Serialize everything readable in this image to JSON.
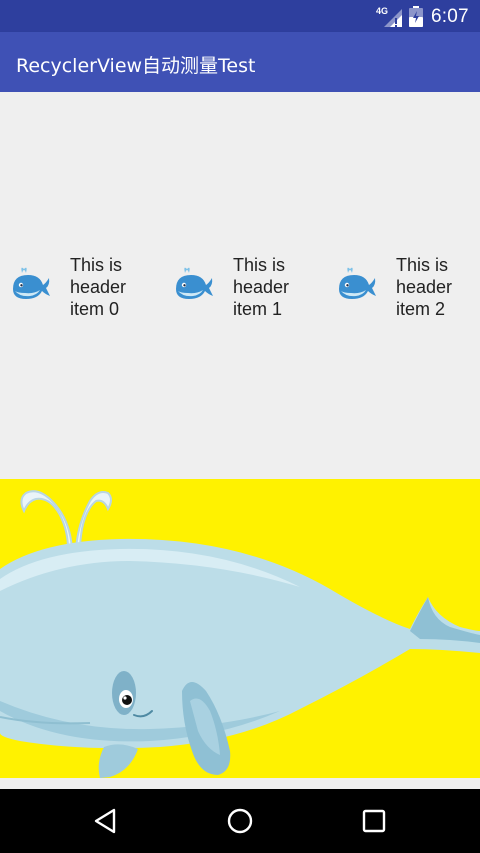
{
  "status_bar": {
    "time": "6:07",
    "network_label": "4G",
    "icons": [
      "signal-4g-icon",
      "battery-icon"
    ]
  },
  "toolbar": {
    "title": "RecyclerView自动测量Test"
  },
  "header_items": [
    {
      "line1": "This is",
      "line2": "header",
      "line3": "item 0",
      "icon": "whale-icon"
    },
    {
      "line1": "This is",
      "line2": "header",
      "line3": "item 1",
      "icon": "whale-icon"
    },
    {
      "line1": "This is",
      "line2": "header",
      "line3": "item 2",
      "icon": "whale-icon"
    }
  ],
  "banner": {
    "image": "whale-illustration",
    "background_color": "#fff200"
  },
  "nav_bar": {
    "buttons": [
      "back-icon",
      "home-icon",
      "recents-icon"
    ]
  },
  "colors": {
    "status_bar": "#2e3f9e",
    "toolbar": "#3f51b5",
    "background": "#efefef",
    "banner_yellow": "#fff200",
    "nav_bar": "#000000"
  }
}
